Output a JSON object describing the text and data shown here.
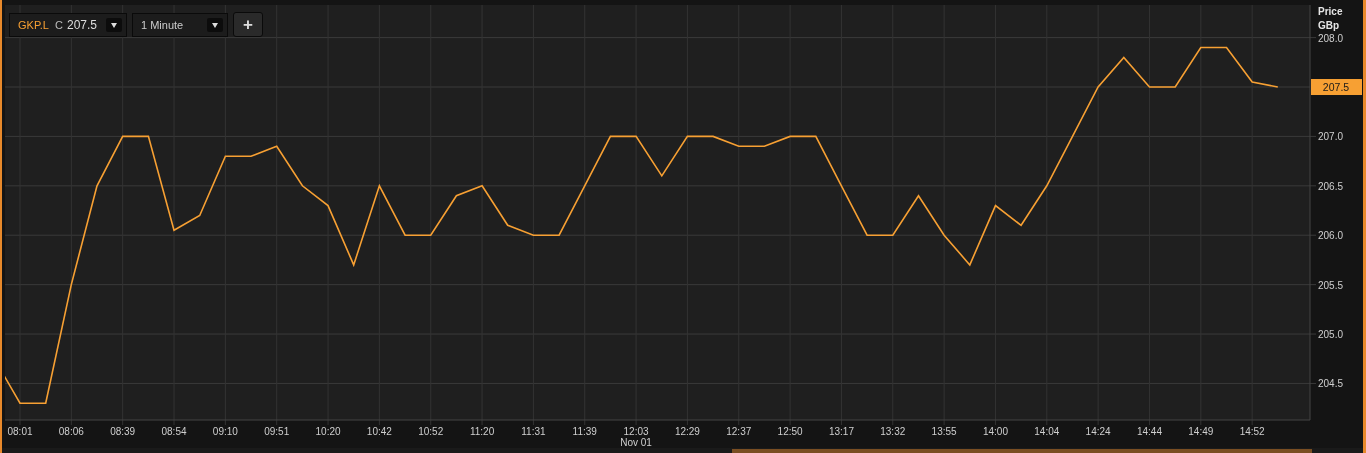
{
  "toolbar": {
    "price_prefix": "C",
    "price": "207.5",
    "interval": "1 Minute",
    "add_button": "+"
  },
  "chart": {
    "axis_title": [
      "Price",
      "GBp"
    ],
    "last_price": "207.5",
    "date_label": "Nov 01",
    "chart_data": {
      "type": "line",
      "categories": [
        null,
        "08:01",
        null,
        "08:06",
        null,
        "08:39",
        null,
        "08:54",
        null,
        "09:10",
        null,
        "09:51",
        null,
        "10:20",
        null,
        "10:42",
        null,
        "10:52",
        null,
        "11:20",
        null,
        "11:31",
        null,
        "11:39",
        null,
        "12:03",
        null,
        "12:29",
        null,
        "12:37",
        null,
        "12:50",
        null,
        "13:17",
        null,
        "13:32",
        null,
        "13:55",
        null,
        "14:00",
        null,
        "14:04",
        null,
        "14:24",
        null,
        "14:44",
        null,
        "14:49",
        null,
        "14:52",
        null
      ],
      "series": [
        {
          "name": "GKP.L",
          "color": "#f7a033",
          "values": [
            204.75,
            204.3,
            204.3,
            205.5,
            206.5,
            207.0,
            207.0,
            206.05,
            206.2,
            206.8,
            206.8,
            206.9,
            206.5,
            206.3,
            205.7,
            206.5,
            206.0,
            206.0,
            206.4,
            206.5,
            206.1,
            206.0,
            206.0,
            206.5,
            207.0,
            207.0,
            206.6,
            207.0,
            207.0,
            206.9,
            206.9,
            207.0,
            207.0,
            206.5,
            206.0,
            206.0,
            206.4,
            206.0,
            205.7,
            206.3,
            206.1,
            206.5,
            207.0,
            207.5,
            207.8,
            207.5,
            207.5,
            207.9,
            207.9,
            207.55,
            207.5
          ]
        }
      ],
      "ylim": [
        204.13,
        208.33
      ],
      "grid": true,
      "yticks": [
        {
          "value": 204.5,
          "label": "204.5"
        },
        {
          "value": 205,
          "label": "205.0"
        },
        {
          "value": 205.5,
          "label": "205.5"
        },
        {
          "value": 206,
          "label": "206.0"
        },
        {
          "value": 206.5,
          "label": "206.5"
        },
        {
          "value": 207,
          "label": "207.0"
        },
        {
          "value": 208,
          "label": "208.0"
        }
      ]
    }
  }
}
